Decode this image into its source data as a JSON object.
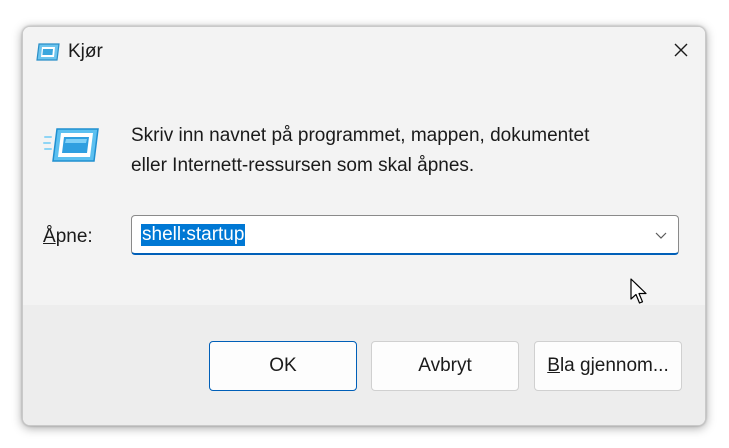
{
  "window": {
    "title": "Kjør",
    "icon": "run-icon",
    "close_icon": "close-icon"
  },
  "dialog": {
    "message_line1": "Skriv inn navnet på programmet, mappen, dokumentet",
    "message_line2": "eller Internett-ressursen som skal åpnes.",
    "open_label_accel": "Å",
    "open_label_rest": "pne:",
    "open_value": "shell:startup",
    "dropdown_icon": "chevron-down-icon"
  },
  "buttons": {
    "ok": "OK",
    "cancel": "Avbryt",
    "browse_accel": "B",
    "browse_rest": "la gjennom..."
  },
  "colors": {
    "accent": "#005fb8",
    "selection": "#0078d4"
  }
}
